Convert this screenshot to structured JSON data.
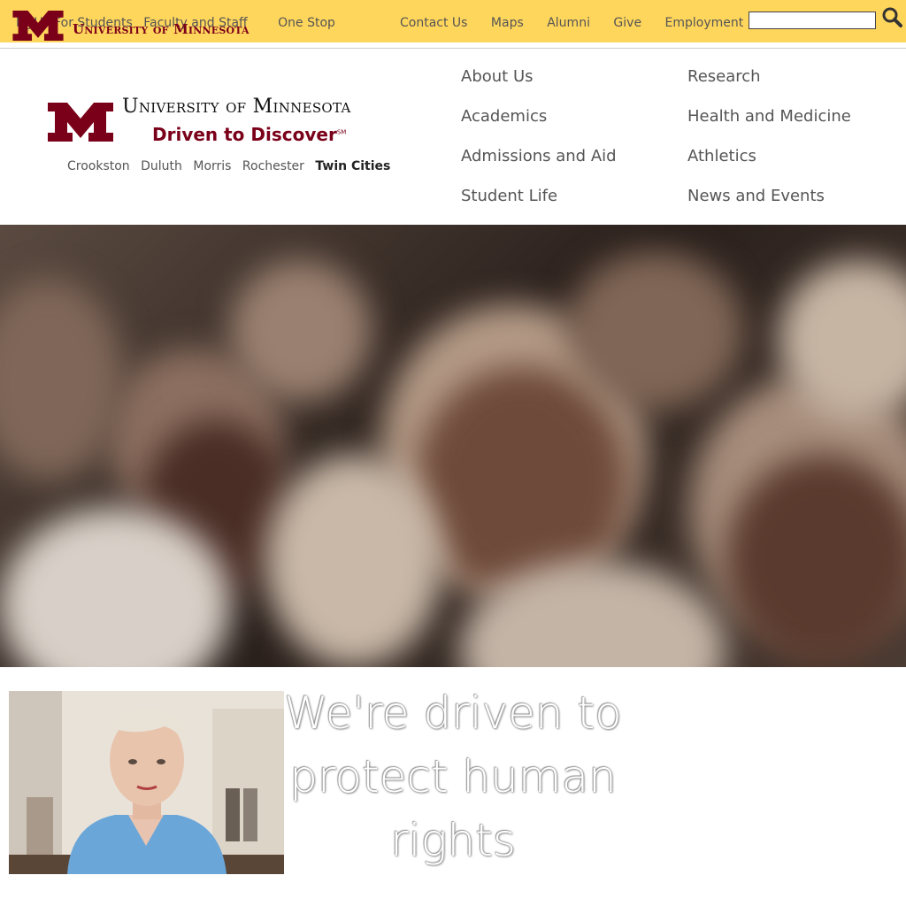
{
  "topbar": {
    "left_links": [
      "MyU",
      "For Students",
      "Faculty and Staff"
    ],
    "one_stop": "One Stop",
    "wordmark": "University of Minnesota",
    "right_links": [
      "Contact Us",
      "Maps",
      "Alumni",
      "Give",
      "Employment"
    ],
    "search_value": "",
    "search_icon": "search-icon",
    "background": "#ffd65c"
  },
  "logo": {
    "name": "University of Minnesota",
    "tagline": "Driven to Discover",
    "tagline_mark": "SM",
    "brand_color": "#7a0019"
  },
  "campuses": [
    "Crookston",
    "Duluth",
    "Morris",
    "Rochester",
    "Twin Cities"
  ],
  "nav": {
    "col1": [
      "About Us",
      "Academics",
      "Admissions and Aid",
      "Student Life"
    ],
    "col2": [
      "Research",
      "Health and Medicine",
      "Athletics",
      "News and Events"
    ]
  },
  "feature": {
    "headline_lines": [
      "We're driven to",
      "protect human",
      "rights"
    ]
  }
}
